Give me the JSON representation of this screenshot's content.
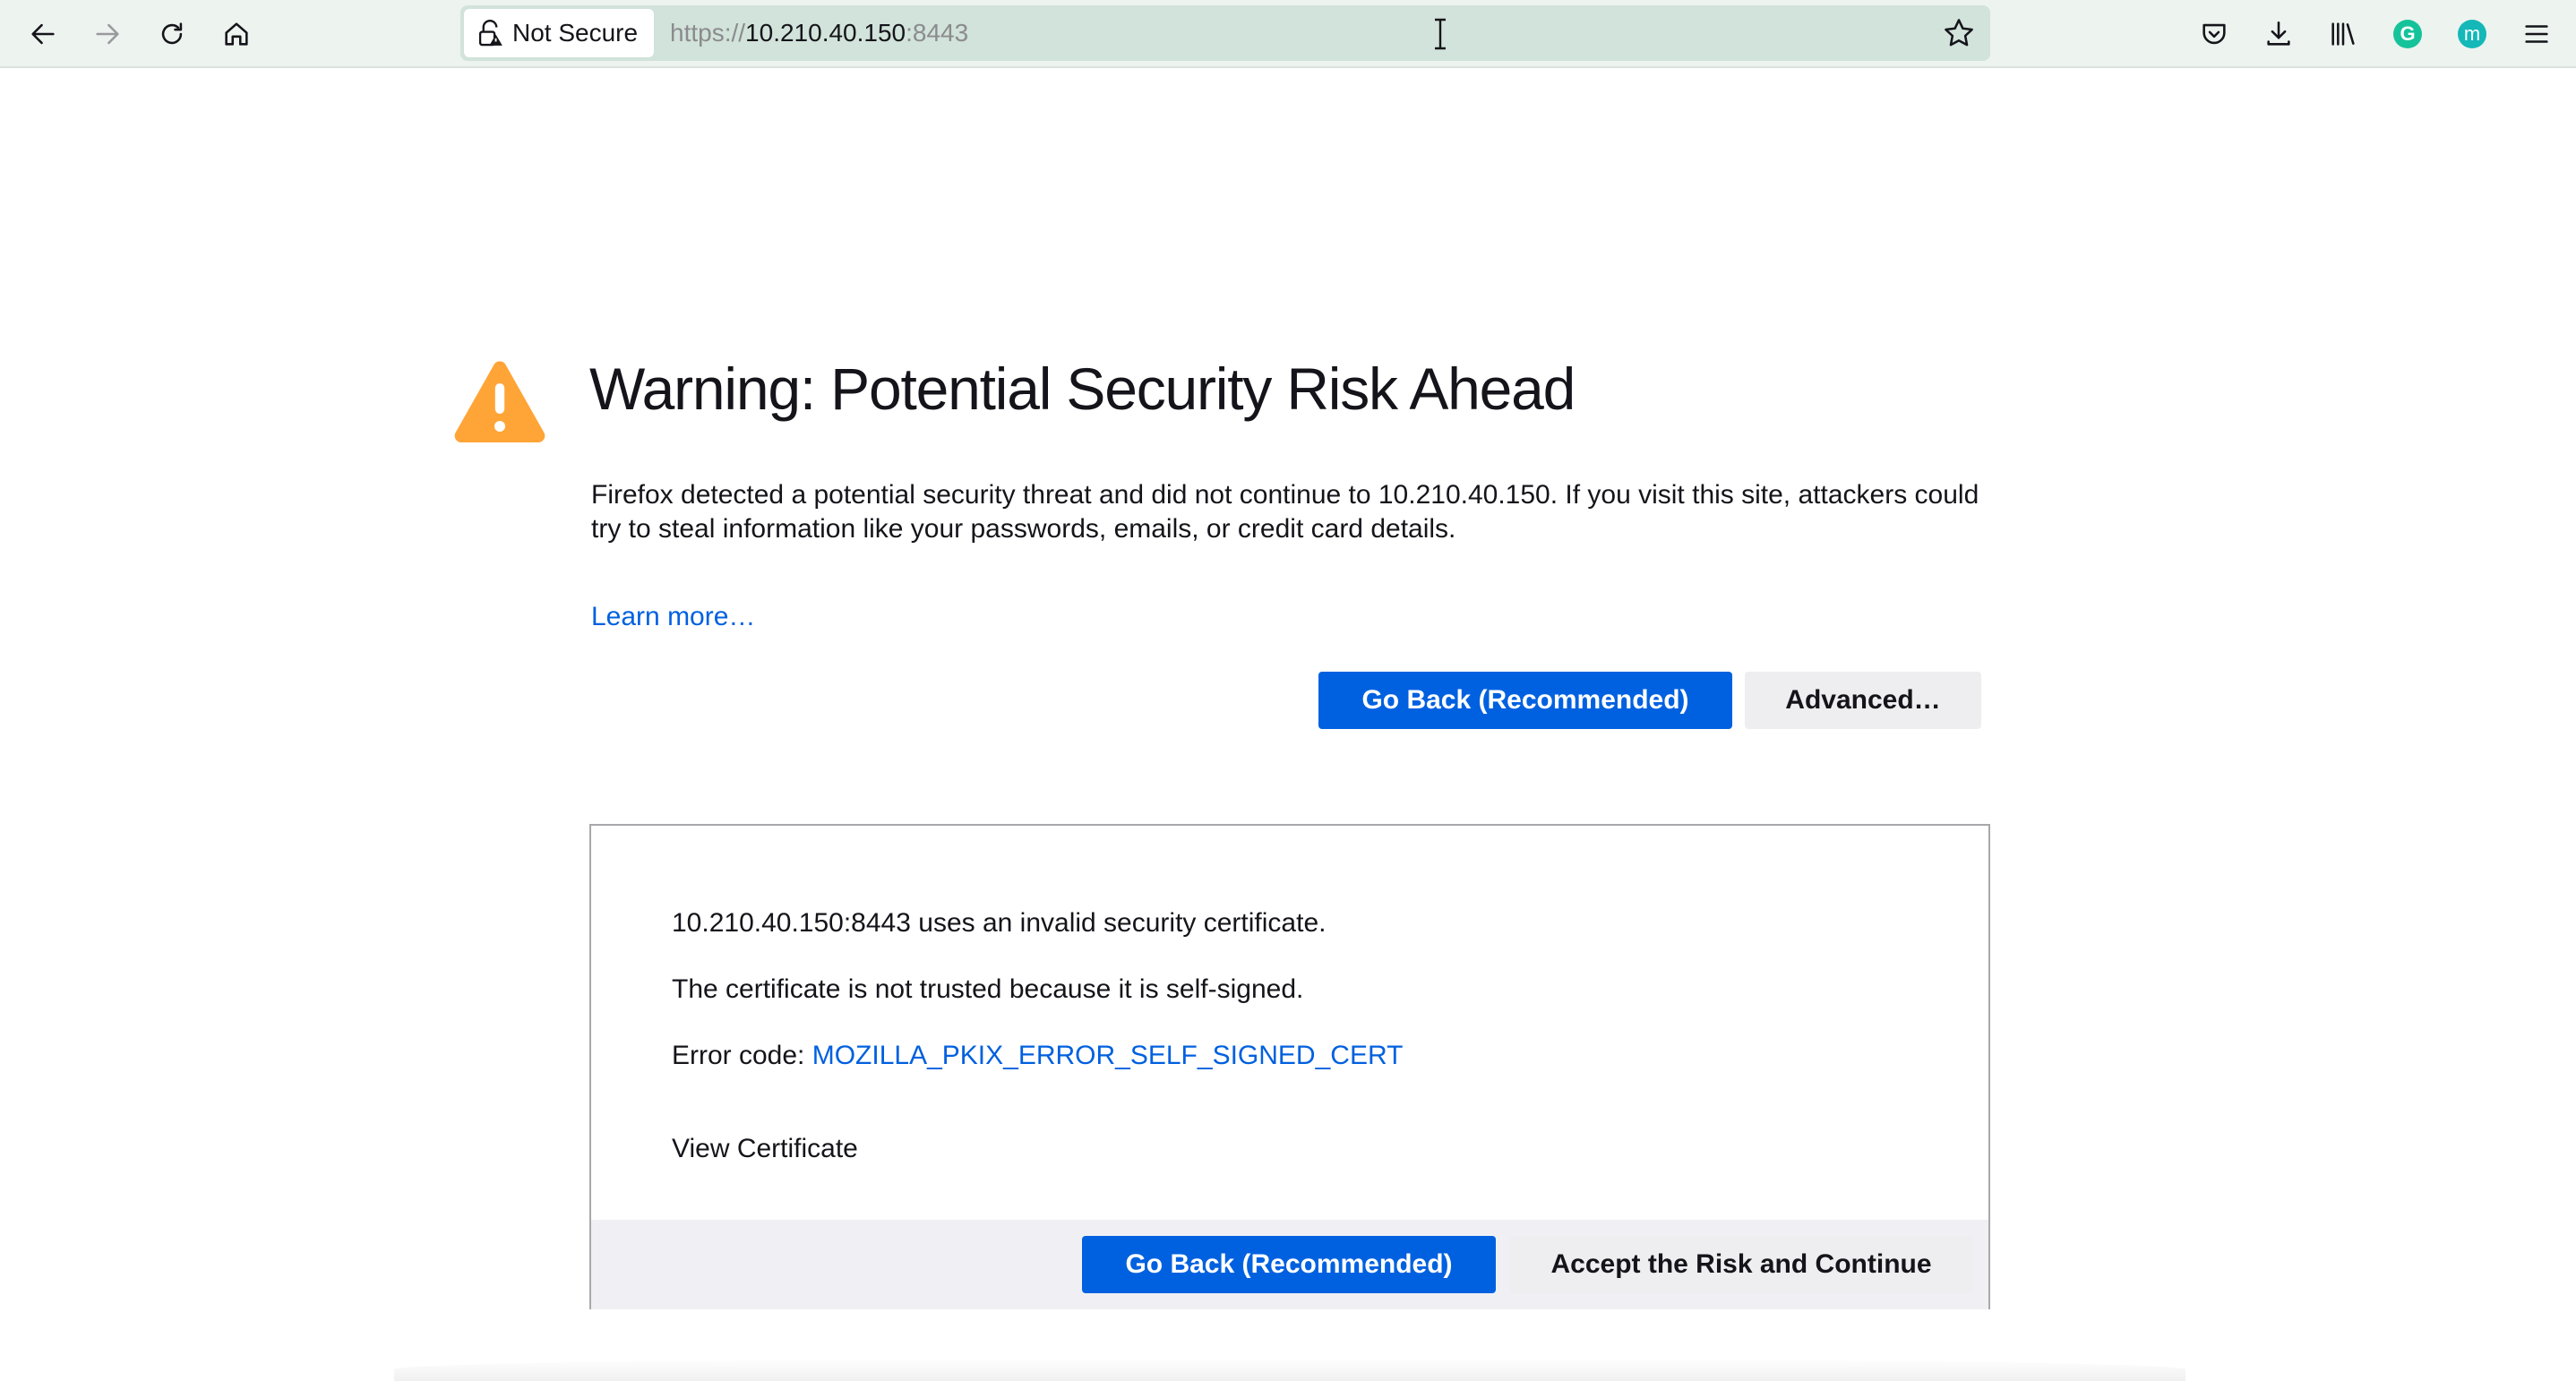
{
  "toolbar": {
    "back_icon": "arrow-left-icon",
    "forward_icon": "arrow-right-icon",
    "reload_icon": "reload-icon",
    "home_icon": "home-icon",
    "identity_label": "Not Secure",
    "url_scheme": "https://",
    "url_host": "10.210.40.150",
    "url_port": ":8443",
    "right_icons": [
      "pocket-icon",
      "download-icon",
      "library-icon",
      "grammarly-icon",
      "account-icon",
      "menu-icon"
    ],
    "grammarly_letter": "G",
    "account_letter": "m",
    "colors": {
      "toolbar_bg": "#edf3ef",
      "urlbar_bg": "#d1e3da",
      "grammarly": "#15c39a",
      "account": "#14b8b8"
    }
  },
  "page": {
    "title": "Warning: Potential Security Risk Ahead",
    "intro": "Firefox detected a potential security threat and did not continue to 10.210.40.150. If you visit this site, attackers could try to steal information like your passwords, emails, or credit card details.",
    "learn_more": "Learn more…",
    "go_back_label": "Go Back (Recommended)",
    "advanced_label": "Advanced…",
    "warning_color": "#ffa436",
    "accent_color": "#0061e0"
  },
  "advanced": {
    "line1": "10.210.40.150:8443 uses an invalid security certificate.",
    "line2": "The certificate is not trusted because it is self-signed.",
    "error_code_prefix": "Error code: ",
    "error_code": "MOZILLA_PKIX_ERROR_SELF_SIGNED_CERT",
    "view_certificate": "View Certificate",
    "go_back_label": "Go Back (Recommended)",
    "accept_label": "Accept the Risk and Continue"
  }
}
